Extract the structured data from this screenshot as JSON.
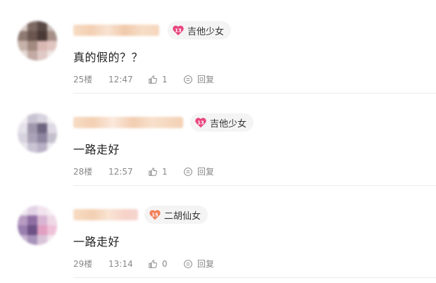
{
  "comments": [
    {
      "content": "真的假的？？",
      "floor": "25楼",
      "time": "12:47",
      "likes": "1",
      "reply_label": "回复",
      "badge": {
        "level": "13",
        "name": "吉他少女",
        "color": "#e8457e"
      }
    },
    {
      "content": "一路走好",
      "floor": "28楼",
      "time": "12:57",
      "likes": "1",
      "reply_label": "回复",
      "badge": {
        "level": "13",
        "name": "吉他少女",
        "color": "#e8457e"
      }
    },
    {
      "content": "一路走好",
      "floor": "29楼",
      "time": "13:14",
      "likes": "0",
      "reply_label": "回复",
      "badge": {
        "level": "15",
        "name": "二胡仙女",
        "color": "#f2805a"
      }
    }
  ],
  "icons": {
    "level_badge": "heart-badge-icon",
    "like": "thumb-up-icon",
    "reply": "reply-bubble-icon"
  }
}
